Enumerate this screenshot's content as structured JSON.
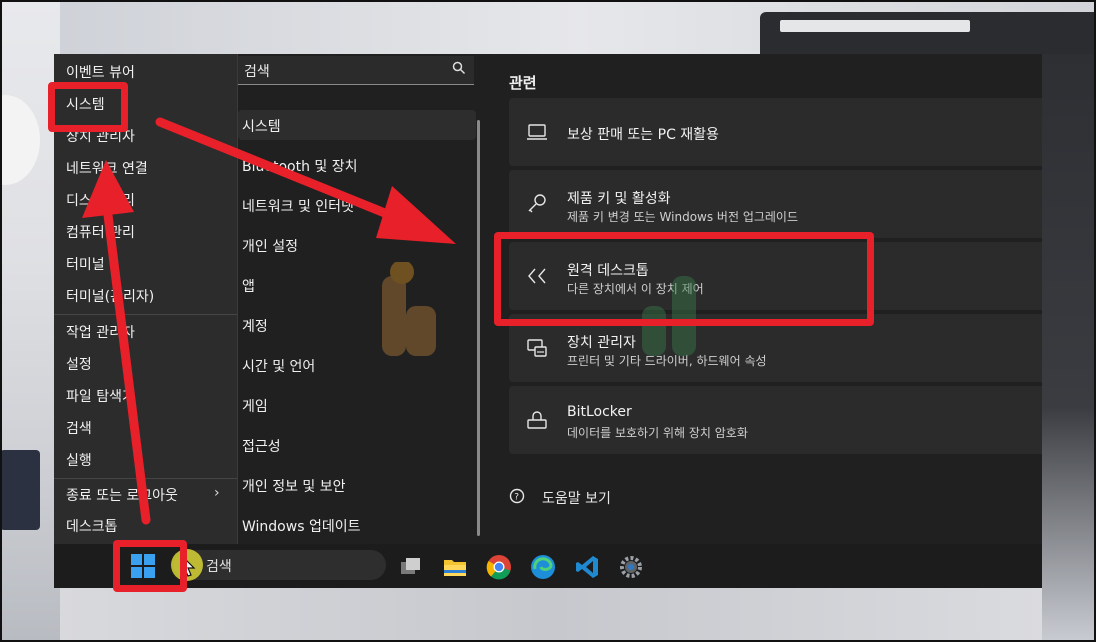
{
  "context_menu": {
    "items": [
      "이벤트 뷰어",
      "시스템",
      "장치 관리자",
      "네트워크 연결",
      "디스크 관리",
      "컴퓨터 관리",
      "터미널",
      "터미널(관리자)",
      "작업 관리자",
      "설정",
      "파일 탐색기",
      "검색",
      "실행",
      "종료 또는 로그아웃",
      "데스크톱"
    ]
  },
  "settings_nav": {
    "search_placeholder": "검색",
    "items": [
      "시스템",
      "Bluetooth 및 장치",
      "네트워크 및 인터넷",
      "개인 설정",
      "앱",
      "계정",
      "시간 및 언어",
      "게임",
      "접근성",
      "개인 정보 및 보안",
      "Windows 업데이트"
    ]
  },
  "related": {
    "title": "관련",
    "cards": [
      {
        "title": "보상 판매 또는 PC 재활용",
        "subtitle": "",
        "icon": "laptop-icon"
      },
      {
        "title": "제품 키 및 활성화",
        "subtitle": "제품 키 변경 또는 Windows 버전 업그레이드",
        "icon": "key-icon"
      },
      {
        "title": "원격 데스크톱",
        "subtitle": "다른 장치에서 이 장치 제어",
        "icon": "remote-desktop-icon"
      },
      {
        "title": "장치 관리자",
        "subtitle": "프린터 및 기타 드라이버, 하드웨어 속성",
        "icon": "device-manager-icon"
      },
      {
        "title": "BitLocker",
        "subtitle": "데이터를 보호하기 위해 장치 암호화",
        "icon": "lock-icon"
      }
    ],
    "help_label": "도움말 보기"
  },
  "taskbar": {
    "search_label": "검색"
  },
  "colors": {
    "annotation_red": "#e8202a",
    "panel_bg": "#202020",
    "card_bg": "#2b2b2b"
  }
}
